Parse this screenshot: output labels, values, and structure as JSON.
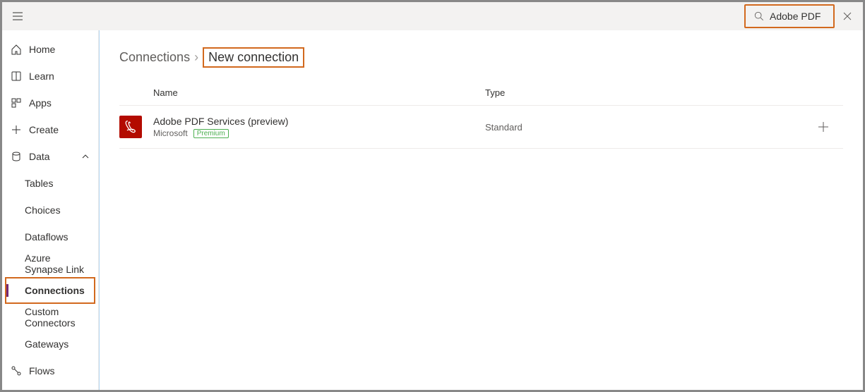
{
  "search": {
    "value": "Adobe PDF"
  },
  "sidebar": {
    "home": "Home",
    "learn": "Learn",
    "apps": "Apps",
    "create": "Create",
    "data": "Data",
    "data_children": {
      "tables": "Tables",
      "choices": "Choices",
      "dataflows": "Dataflows",
      "synapse": "Azure Synapse Link",
      "connections": "Connections",
      "custom": "Custom Connectors",
      "gateways": "Gateways"
    },
    "flows": "Flows"
  },
  "breadcrumb": {
    "root": "Connections",
    "current": "New connection"
  },
  "table": {
    "col_name": "Name",
    "col_type": "Type",
    "rows": [
      {
        "name": "Adobe PDF Services (preview)",
        "publisher": "Microsoft",
        "badge": "Premium",
        "type": "Standard"
      }
    ]
  }
}
